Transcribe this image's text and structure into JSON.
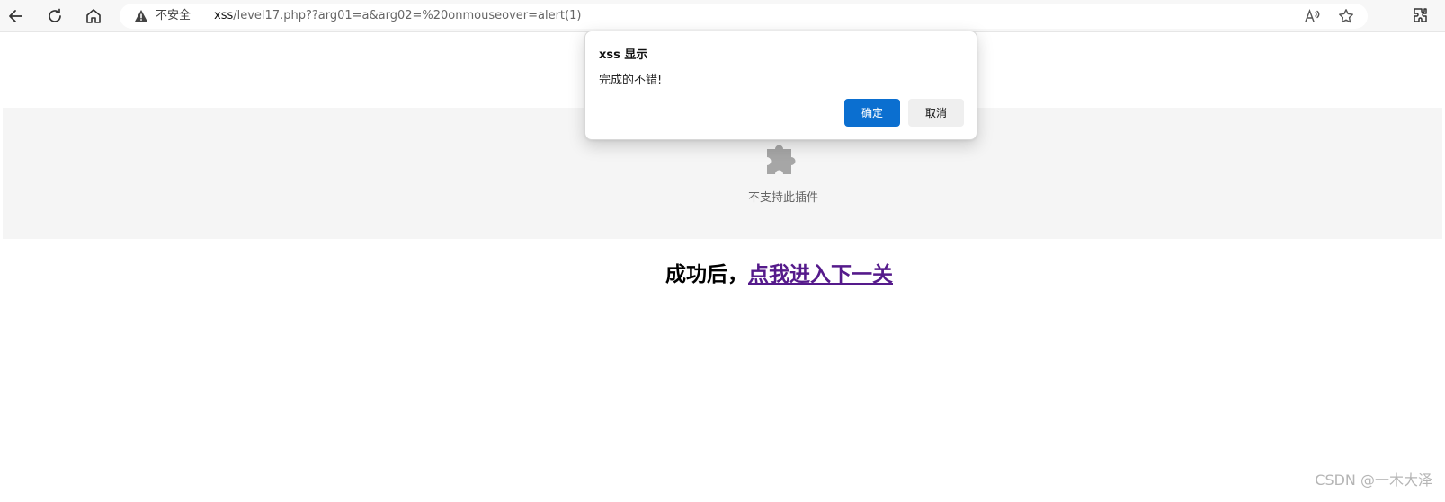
{
  "browser": {
    "security_label": "不安全",
    "url_host": "xss",
    "url_path": "/level17.php??arg01=a&arg02=%20onmouseover=alert(1)",
    "icons": [
      "back-icon",
      "refresh-icon",
      "home-icon",
      "warning-icon",
      "read-aloud-icon",
      "favorite-star-icon",
      "extensions-icon"
    ]
  },
  "plugin": {
    "message": "不支持此插件",
    "icon": "puzzle-icon"
  },
  "page": {
    "success_prefix": "成功后，",
    "next_link": "点我进入下一关"
  },
  "dialog": {
    "title": "xss 显示",
    "message": "完成的不错!",
    "ok_label": "确定",
    "cancel_label": "取消"
  },
  "watermark": "CSDN @一木大泽",
  "colors": {
    "accent": "#0b6fd0",
    "link_visited": "#551a8b"
  }
}
